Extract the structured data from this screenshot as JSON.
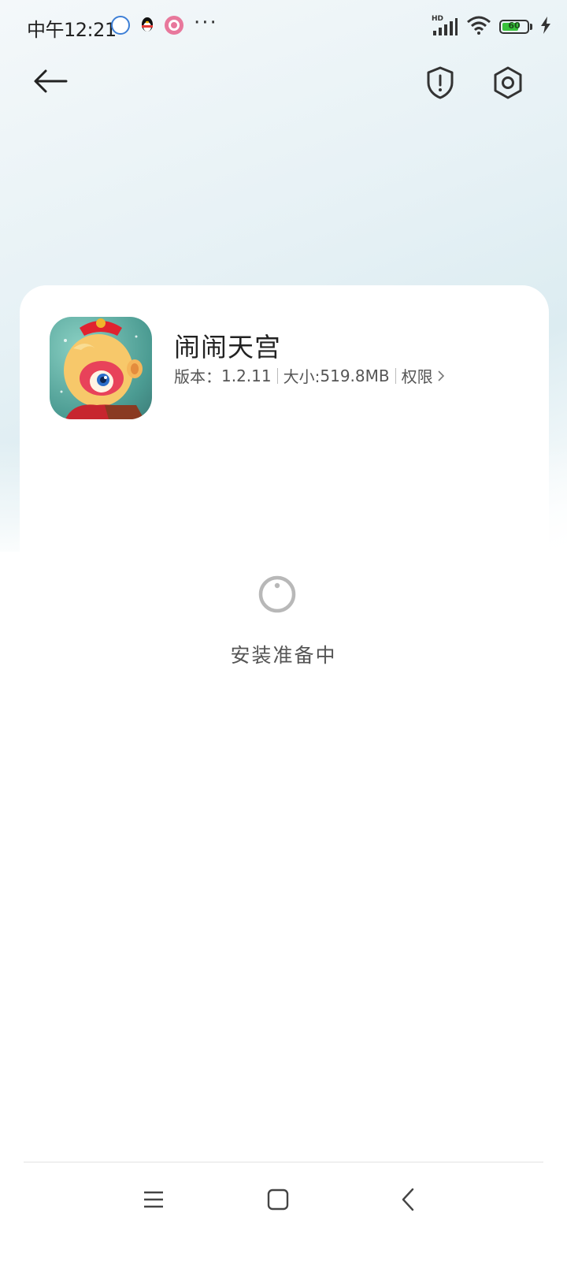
{
  "status_bar": {
    "time": "中午12:21",
    "more": "···",
    "network_badge": "HD",
    "battery_level": "60",
    "notification_icons": [
      "app-notification-icon",
      "qq-icon",
      "app-notification-icon"
    ]
  },
  "header": {
    "back_icon": "arrow-left-icon",
    "actions": [
      "shield-alert-icon",
      "settings-icon"
    ]
  },
  "app": {
    "name": "闹闹天宫",
    "version_label": "版本：",
    "version": "1.2.11",
    "size_label": "大小:",
    "size": "519.8MB",
    "permissions_label": "权限"
  },
  "install": {
    "status_text": "安装准备中"
  },
  "navigation_bar": {
    "buttons": [
      "menu-icon",
      "home-icon",
      "back-icon"
    ]
  },
  "colors": {
    "accent_battery": "#39c23b",
    "text_primary": "#222222",
    "text_secondary": "#555555",
    "spinner": "#b8b8b8"
  }
}
